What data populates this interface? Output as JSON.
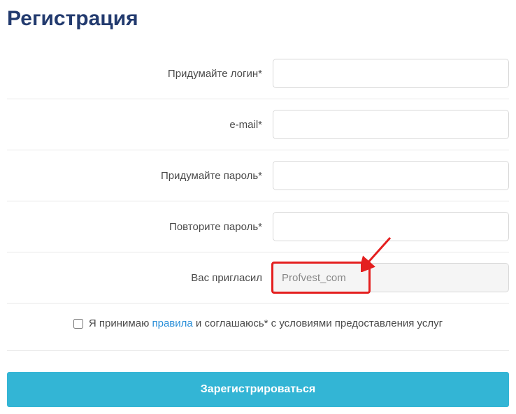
{
  "title": "Регистрация",
  "fields": {
    "login": {
      "label": "Придумайте логин*",
      "value": ""
    },
    "email": {
      "label": "e-mail*",
      "value": ""
    },
    "password": {
      "label": "Придумайте пароль*",
      "value": ""
    },
    "password_confirm": {
      "label": "Повторите пароль*",
      "value": ""
    },
    "referrer": {
      "label": "Вас пригласил",
      "value": "Profvest_com"
    }
  },
  "terms": {
    "prefix": "Я принимаю ",
    "link_text": "правила",
    "suffix": " и соглашаюсь* с условиями предоставления услуг"
  },
  "submit_label": "Зарегистрироваться"
}
